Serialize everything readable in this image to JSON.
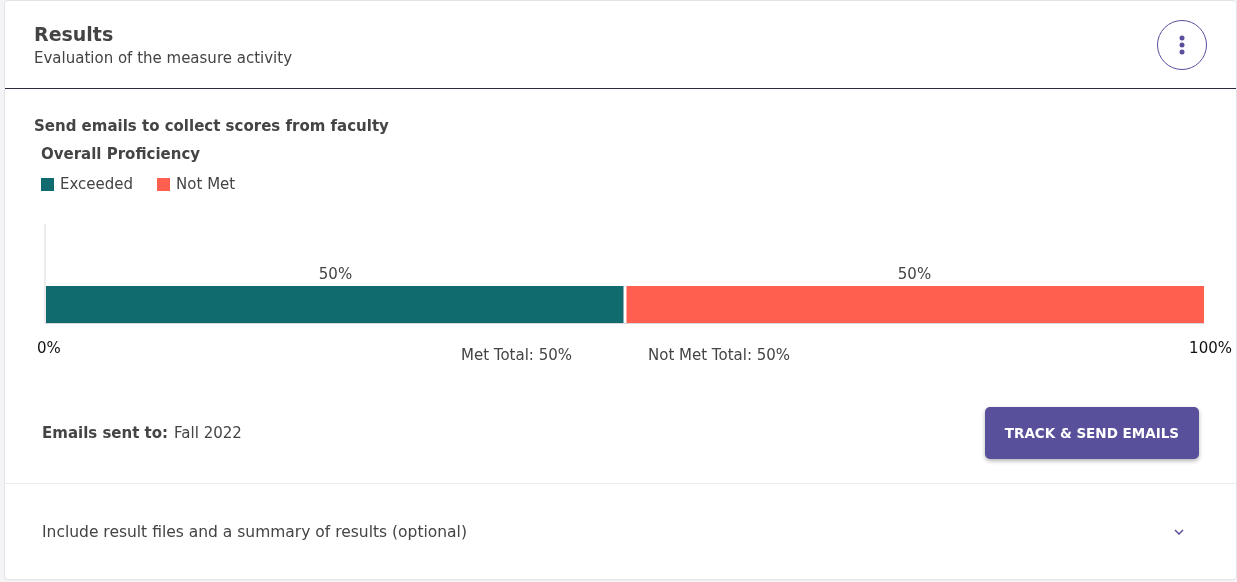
{
  "header": {
    "title": "Results",
    "subtitle": "Evaluation of the measure activity"
  },
  "section_title": "Send emails to collect scores from faculty",
  "chart": {
    "chart_data": {
      "type": "bar",
      "orientation": "horizontal",
      "stacked": true,
      "title": "Overall Proficiency",
      "series": [
        {
          "name": "Exceeded",
          "color": "#0f6b6e",
          "values": [
            50
          ]
        },
        {
          "name": "Not Met",
          "color": "#ff5f4f",
          "values": [
            50
          ]
        }
      ],
      "xlim": [
        0,
        100
      ],
      "xticks": [
        {
          "value": 0,
          "label": "0%"
        },
        {
          "value": 100,
          "label": "100%"
        }
      ],
      "value_labels": [
        "50%",
        "50%"
      ]
    },
    "totals": [
      "Met Total: 50%",
      "Not Met Total: 50%"
    ]
  },
  "emails": {
    "label": "Emails sent to:",
    "value": "Fall 2022"
  },
  "button": "TRACK & SEND EMAILS",
  "accordion": {
    "label": "Include result files and a summary of results (optional)",
    "expanded": false
  }
}
